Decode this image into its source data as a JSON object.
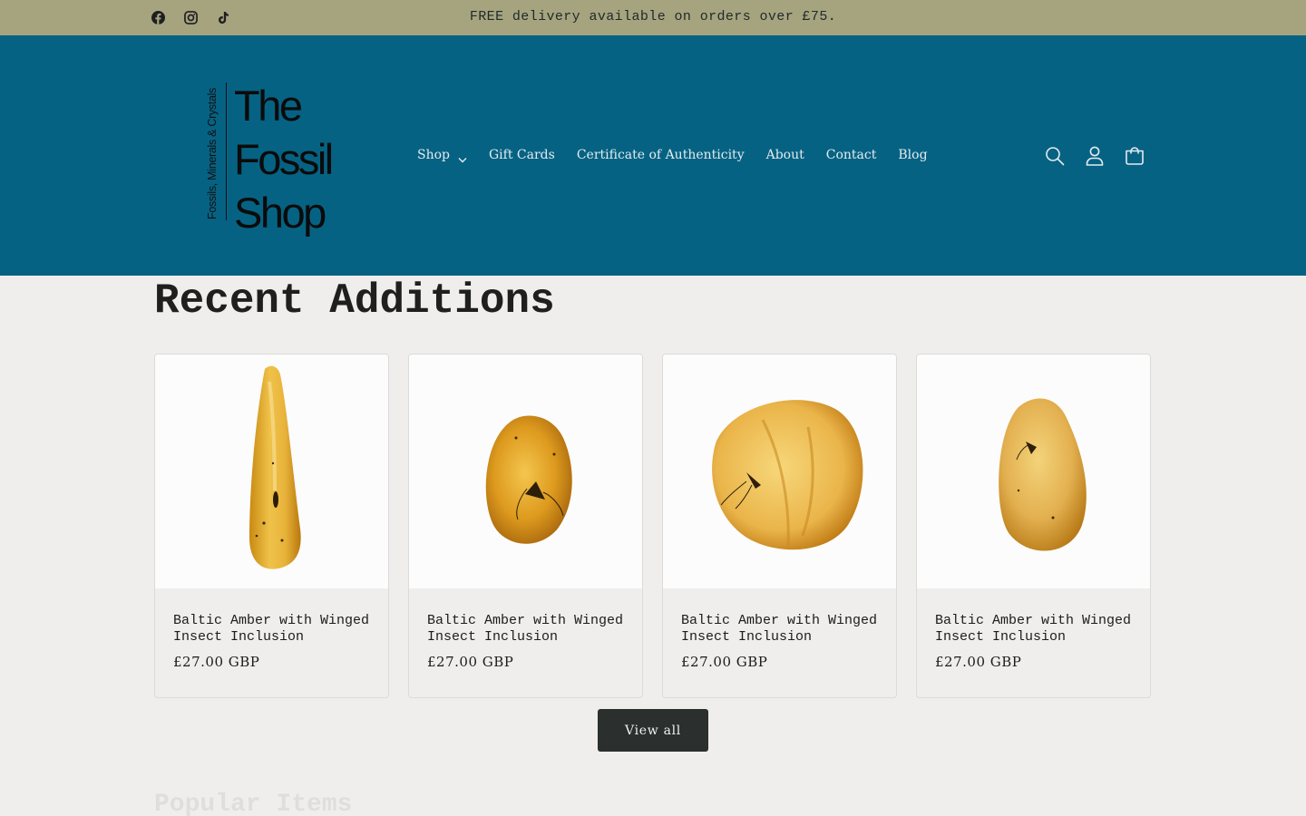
{
  "announcement": {
    "text": "FREE delivery available on orders over £75.",
    "socials": [
      {
        "name": "Facebook",
        "icon": "facebook-icon"
      },
      {
        "name": "Instagram",
        "icon": "instagram-icon"
      },
      {
        "name": "TikTok",
        "icon": "tiktok-icon"
      }
    ]
  },
  "header": {
    "logo": {
      "words": [
        "The",
        "Fossil",
        "Shop"
      ],
      "tagline": "Fossils, Minerals & Crystals"
    },
    "nav": [
      {
        "label": "Shop",
        "has_dropdown": true
      },
      {
        "label": "Gift Cards"
      },
      {
        "label": "Certificate of Authenticity"
      },
      {
        "label": "About"
      },
      {
        "label": "Contact"
      },
      {
        "label": "Blog"
      }
    ],
    "icons": [
      "search-icon",
      "account-icon",
      "cart-icon"
    ]
  },
  "recent": {
    "title": "Recent Additions",
    "products": [
      {
        "title": "Baltic Amber with Winged Insect Inclusion",
        "price": "£27.00 GBP"
      },
      {
        "title": "Baltic Amber with Winged Insect Inclusion",
        "price": "£27.00 GBP"
      },
      {
        "title": "Baltic Amber with Winged Insect Inclusion",
        "price": "£27.00 GBP"
      },
      {
        "title": "Baltic Amber with Winged Insect Inclusion",
        "price": "£27.00 GBP"
      }
    ],
    "view_all_label": "View all"
  },
  "next_section": {
    "title": "Popular Items"
  },
  "colors": {
    "announcement_bg": "#a6a47f",
    "header_bg": "#066283",
    "page_bg": "#efeeec",
    "button_bg": "#2b2f2d",
    "amber": "#e2a52b"
  }
}
